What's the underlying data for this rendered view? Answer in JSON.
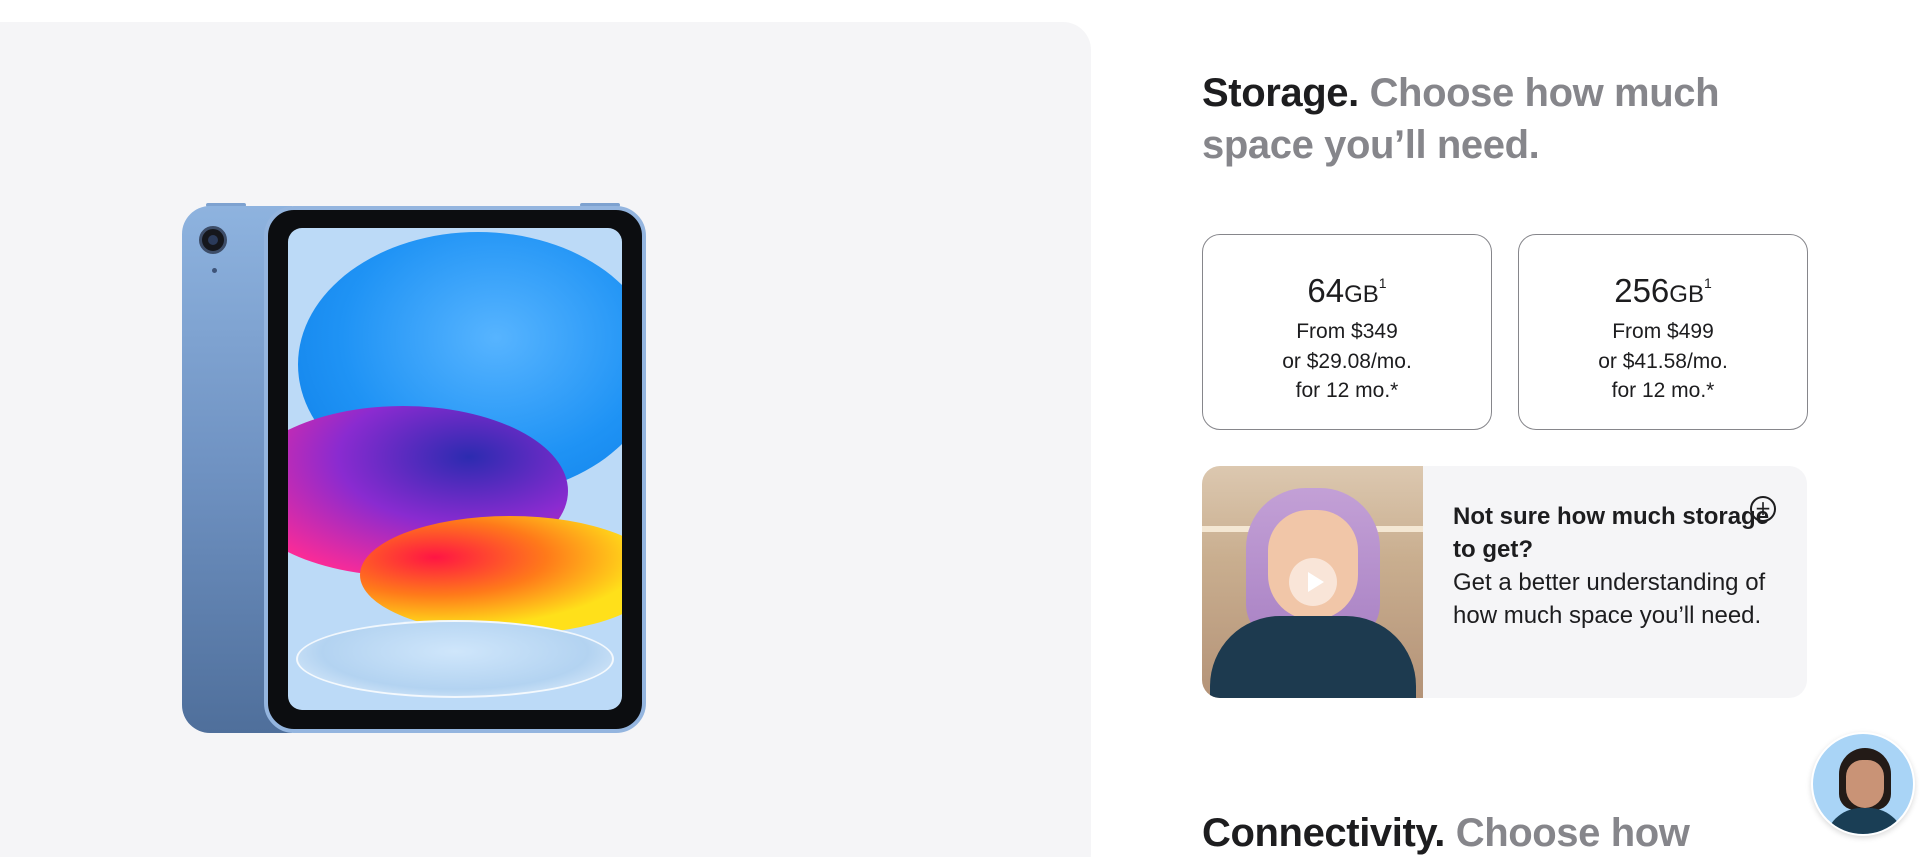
{
  "storage_section": {
    "title": "Storage.",
    "subtitle": "Choose how much space you’ll need.",
    "options": [
      {
        "capacity": "64",
        "unit": "GB",
        "footnote": "1",
        "price": "From $349",
        "monthly": "or $29.08/mo.",
        "term": "for 12 mo.*"
      },
      {
        "capacity": "256",
        "unit": "GB",
        "footnote": "1",
        "price": "From $499",
        "monthly": "or $41.58/mo.",
        "term": "for 12 mo.*"
      }
    ],
    "help": {
      "title": "Not sure how much storage to get?",
      "body": "Get a better understanding of how much space you’ll need.",
      "expand_icon": "plus-circle-icon",
      "video_icon": "play-icon"
    }
  },
  "connectivity_section": {
    "title": "Connectivity.",
    "subtitle": "Choose how"
  },
  "colors": {
    "text": "#1d1d1f",
    "muted": "#86868b",
    "panel": "#f5f5f7",
    "ipad_blue": "#8eb3df"
  }
}
